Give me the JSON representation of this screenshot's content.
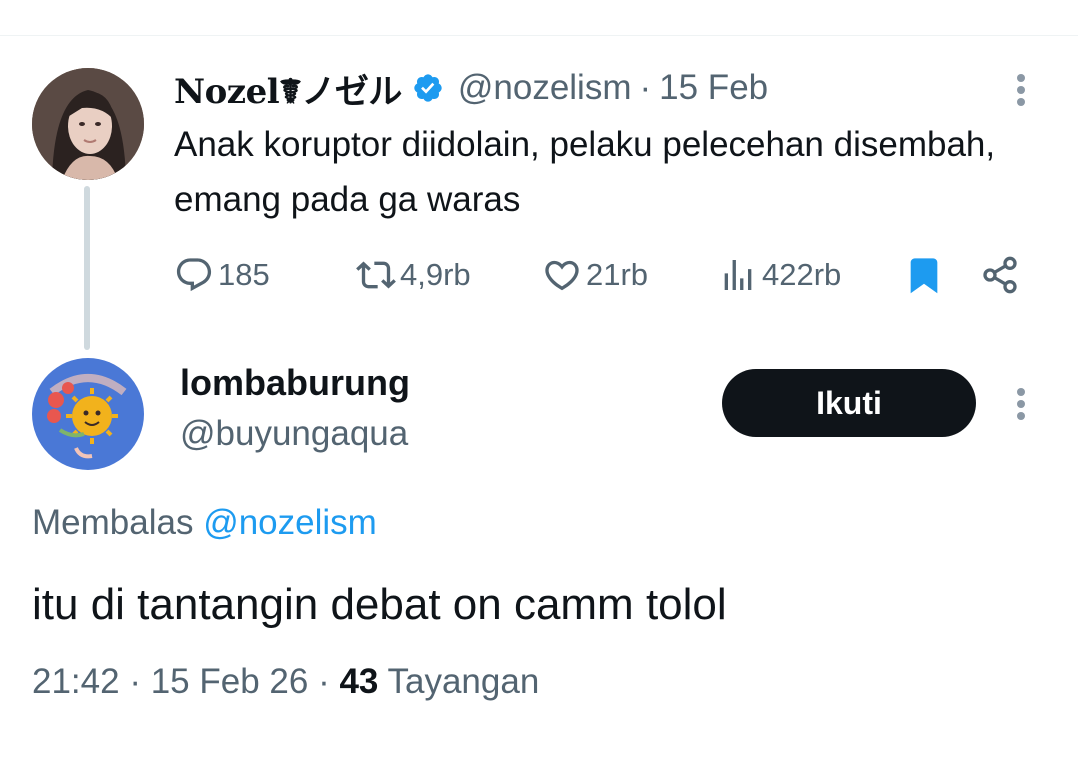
{
  "parent_tweet": {
    "display_name": "Nozel☤ノゼル",
    "handle": "@nozelism",
    "separator": "·",
    "date": "15 Feb",
    "text": "Anak koruptor diidolain, pelaku pelecehan disembah, emang pada ga waras",
    "actions": {
      "reply_count": "185",
      "retweet_count": "4,9rb",
      "like_count": "21rb",
      "view_count": "422rb"
    },
    "bookmarked": true
  },
  "reply_tweet": {
    "display_name": "lombaburung",
    "handle": "@buyungaqua",
    "follow_label": "Ikuti",
    "replying_prefix": "Membalas",
    "replying_to": "@nozelism",
    "text": "itu di tantangin debat on camm tolol",
    "time": "21:42",
    "separator": "·",
    "date": "15 Feb 26",
    "views_count": "43",
    "views_label": "Tayangan"
  },
  "colors": {
    "accent": "#1d9bf0",
    "text_primary": "#0f1419",
    "text_secondary": "#536471",
    "thread_line": "#cfd9de"
  },
  "icons": [
    "verified-badge-icon",
    "more-icon",
    "reply-icon",
    "retweet-icon",
    "like-icon",
    "views-icon",
    "bookmark-icon",
    "share-icon"
  ]
}
